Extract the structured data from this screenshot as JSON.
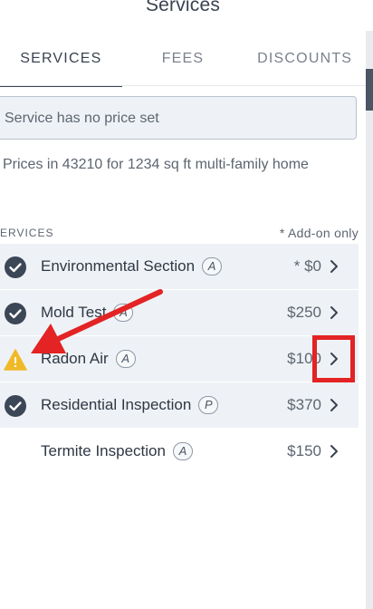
{
  "header": {
    "title": "Services"
  },
  "tabs": [
    {
      "label": "SERVICES",
      "active": true
    },
    {
      "label": "FEES",
      "active": false
    },
    {
      "label": "DISCOUNTS",
      "active": false
    }
  ],
  "notice": {
    "text": "Service has no price set"
  },
  "pricing_note": "Prices in 43210 for 1234 sq ft multi-family home",
  "services_section": {
    "header": "ERVICES",
    "legend": "* Add-on only"
  },
  "services": [
    {
      "name": "Environmental Section",
      "badge": "A",
      "price": "* $0",
      "status": "check-circle-icon"
    },
    {
      "name": "Mold Test",
      "badge": "A",
      "price": "$250",
      "status": "check-circle-icon"
    },
    {
      "name": "Radon Air",
      "badge": "A",
      "price": "$100",
      "status": "warning-triangle-icon"
    },
    {
      "name": "Residential Inspection",
      "badge": "P",
      "price": "$370",
      "status": "check-circle-icon"
    },
    {
      "name": "Termite Inspection",
      "badge": "A",
      "price": "$150",
      "status": "none"
    }
  ],
  "colors": {
    "accent": "#3b4657",
    "row_bg": "#eef2f6",
    "warning": "#f0b928",
    "annotation": "#e32324"
  }
}
